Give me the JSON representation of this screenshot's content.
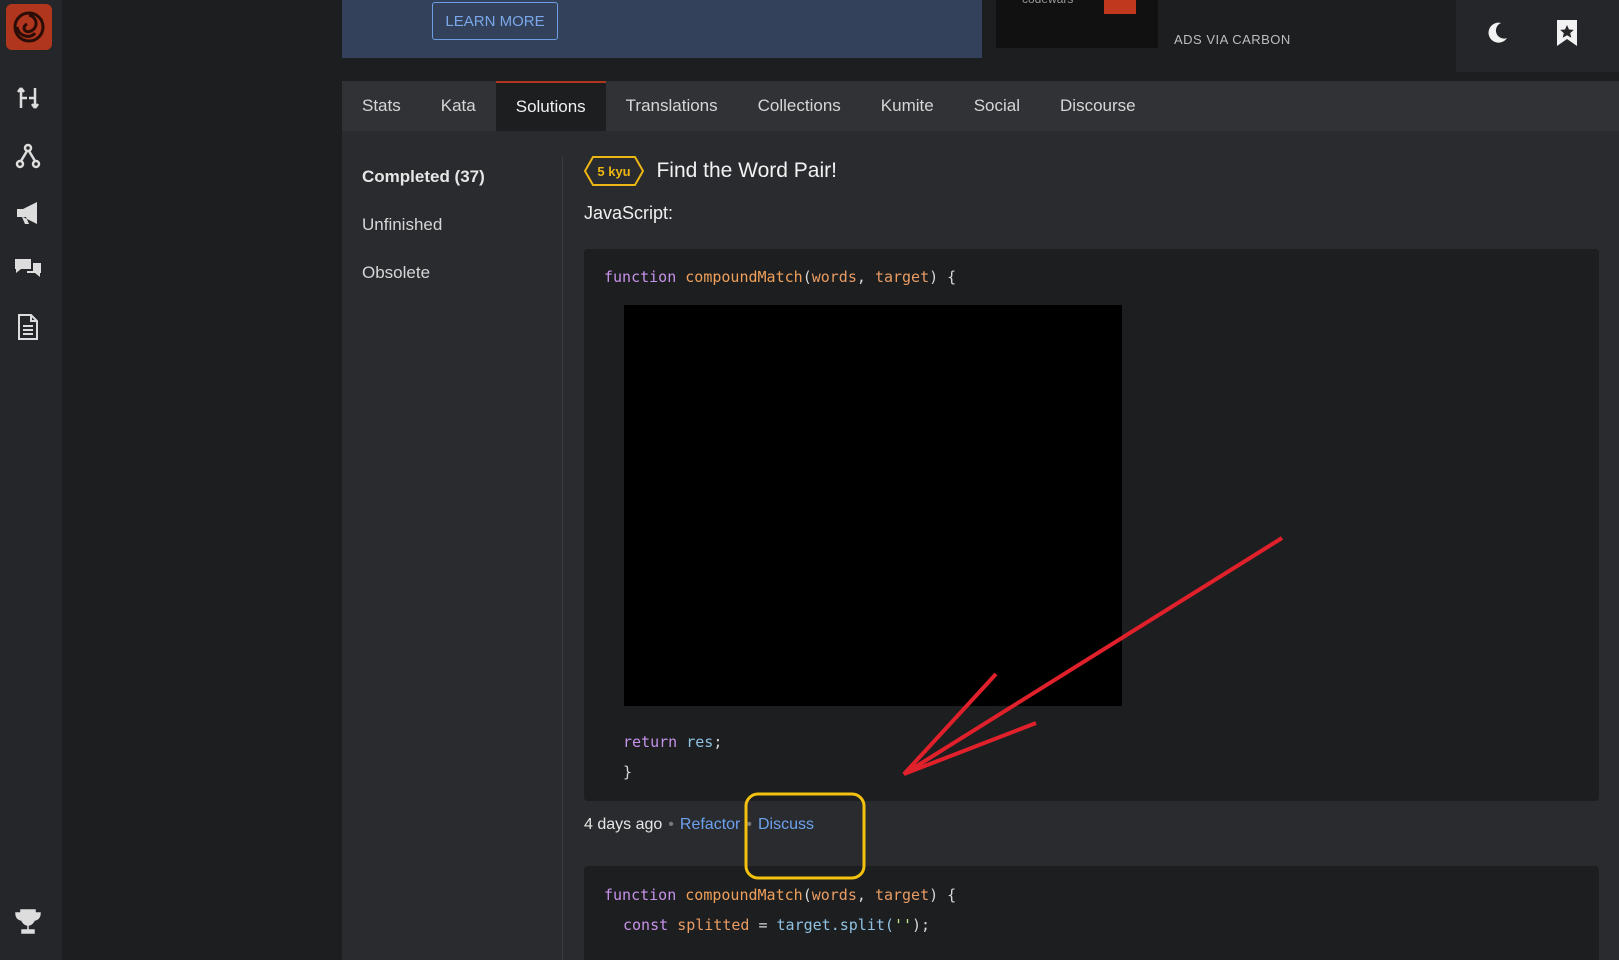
{
  "ad": {
    "learn_more": "LEARN MORE",
    "ads_via": "ADS VIA CARBON",
    "brand": "codewars"
  },
  "tabs": [
    {
      "label": "Stats"
    },
    {
      "label": "Kata"
    },
    {
      "label": "Solutions"
    },
    {
      "label": "Translations"
    },
    {
      "label": "Collections"
    },
    {
      "label": "Kumite"
    },
    {
      "label": "Social"
    },
    {
      "label": "Discourse"
    }
  ],
  "active_tab": "Solutions",
  "filters": [
    {
      "label": "Completed (37)"
    },
    {
      "label": "Unfinished"
    },
    {
      "label": "Obsolete"
    }
  ],
  "kata": {
    "rank": "5 kyu",
    "title": "Find the Word Pair!",
    "language": "JavaScript:"
  },
  "solution1": {
    "line1": {
      "kw": "function",
      "fn": "compoundMatch",
      "p1": "words",
      "p2": "target",
      "open": "(",
      "comma": ", ",
      "close": ") {"
    },
    "return_kw": "return",
    "return_var": "res",
    "return_end": ";",
    "closing": "}"
  },
  "meta": {
    "time": "4 days ago",
    "refactor": "Refactor",
    "discuss": "Discuss",
    "sep": "•"
  },
  "solution2": {
    "line1": {
      "kw": "function",
      "fn": "compoundMatch",
      "p1": "words",
      "p2": "target",
      "open": "(",
      "comma": ", ",
      "close": ") {"
    },
    "line2": {
      "kw": "const",
      "var": "splitted",
      "eq": " = ",
      "obj": "target",
      "method": ".split(",
      "str": "''",
      "end": ");"
    }
  },
  "colors": {
    "accent": "#b1361e",
    "kyu": "#ecb613",
    "link": "#6ca1ef",
    "annotation_arrow": "#e0202a",
    "annotation_box": "#f2c20f"
  }
}
